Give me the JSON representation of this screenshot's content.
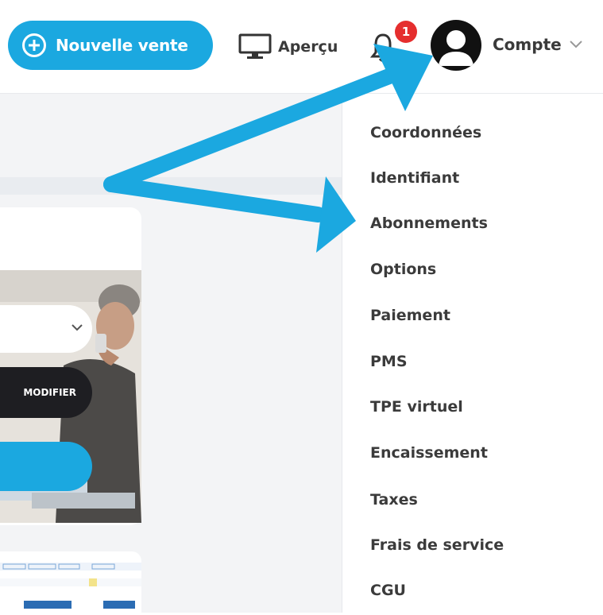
{
  "header": {
    "new_sale_label": "Nouvelle vente",
    "preview_label": "Aperçu",
    "notification_count": "1",
    "account_label": "Compte"
  },
  "card": {
    "modify_label": "MODIFIER"
  },
  "account_menu": {
    "items": [
      {
        "label": "Coordonnées"
      },
      {
        "label": "Identifiant"
      },
      {
        "label": "Abonnements"
      },
      {
        "label": "Options"
      },
      {
        "label": "Paiement"
      },
      {
        "label": "PMS"
      },
      {
        "label": "TPE virtuel"
      },
      {
        "label": "Encaissement"
      },
      {
        "label": "Taxes"
      },
      {
        "label": "Frais de service"
      },
      {
        "label": "CGU"
      }
    ]
  },
  "colors": {
    "accent": "#1ba8e0",
    "badge": "#e52e2e",
    "dark_button": "#1e1e22"
  }
}
